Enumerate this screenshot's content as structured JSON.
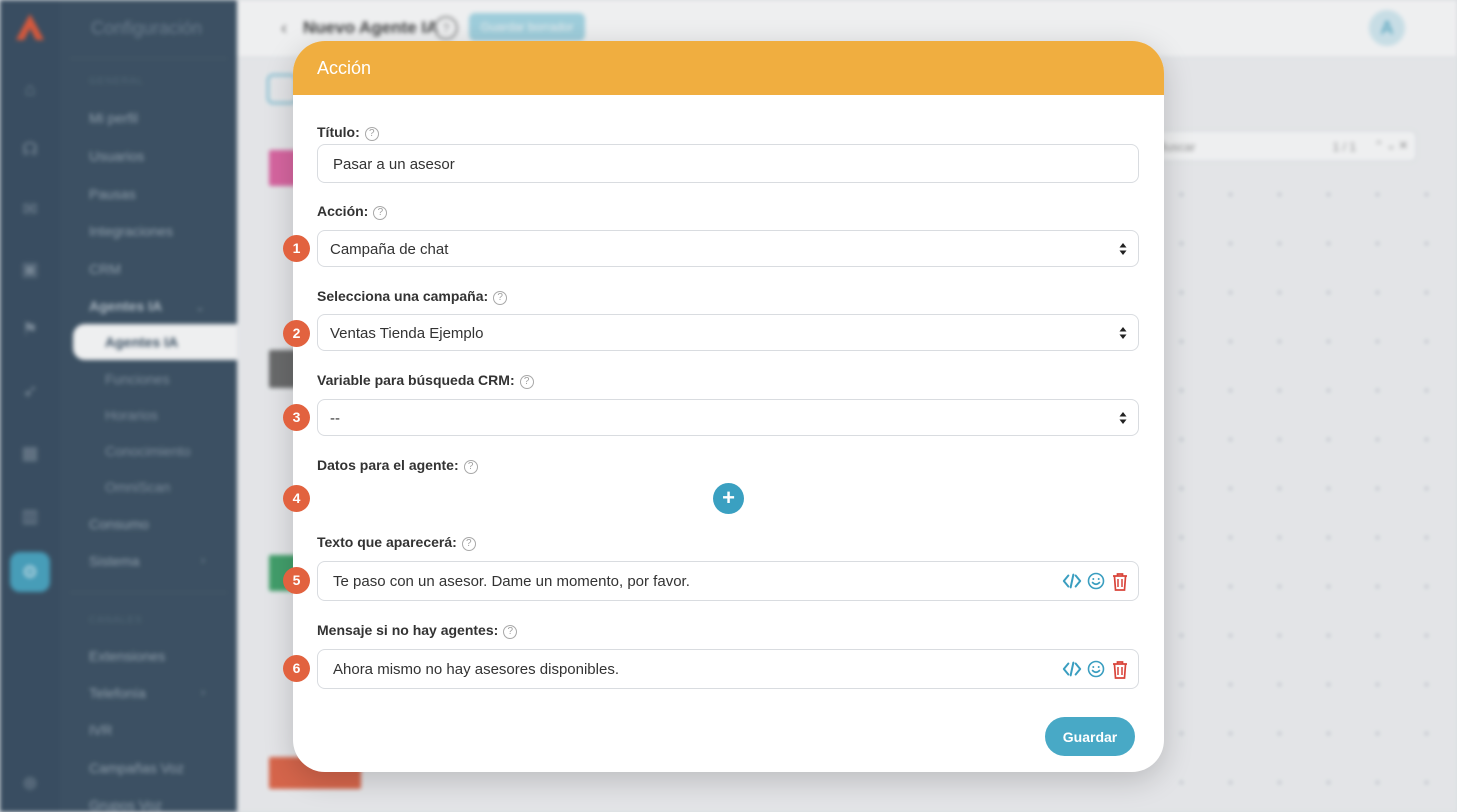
{
  "app": {
    "sidebar_title": "Configuración",
    "section_general": "GENERAL",
    "section_channels": "CANALES",
    "menu": {
      "mi_perfil": "Mi perfil",
      "usuarios": "Usuarios",
      "pausas": "Pausas",
      "integraciones": "Integraciones",
      "crm": "CRM",
      "agentes_ia": "Agentes IA",
      "sub_agentes_ia": "Agentes IA",
      "sub_funciones": "Funciones",
      "sub_horarios": "Horarios",
      "sub_conocimiento": "Conocimiento",
      "sub_omniscan": "OmniScan",
      "consumo": "Consumo",
      "sistema": "Sistema",
      "extensiones": "Extensiones",
      "telefonia": "Telefonía",
      "ivr": "IVR",
      "campanas_voz": "Campañas Voz",
      "grupos_voz": "Grupos Voz"
    },
    "page_title": "Nuevo Agente IA",
    "header_button": "Guardar borrador",
    "avatar_initial": "A",
    "search_placeholder": "Buscar",
    "search_count": "1 / 1"
  },
  "modal": {
    "title": "Acción",
    "fields": {
      "titulo_label": "Título:",
      "titulo_value": "Pasar a un asesor",
      "accion_label": "Acción:",
      "accion_value": "Campaña de chat",
      "campana_label": "Selecciona una campaña:",
      "campana_value": "Ventas Tienda Ejemplo",
      "variable_label": "Variable para búsqueda CRM:",
      "variable_value": "--",
      "datos_label": "Datos para el agente:",
      "texto_label": "Texto que aparecerá:",
      "texto_value": "Te paso con un asesor. Dame un momento, por favor.",
      "mensaje_label": "Mensaje si no hay agentes:",
      "mensaje_value": "Ahora mismo no hay asesores disponibles."
    },
    "badges": [
      "1",
      "2",
      "3",
      "4",
      "5",
      "6"
    ],
    "add_symbol": "+",
    "help_symbol": "?",
    "save_label": "Guardar"
  },
  "colors": {
    "header_orange": "#f0ae40",
    "badge_red": "#e2623f",
    "accent_blue": "#48a9c6",
    "delete_red": "#d9443a"
  },
  "icons": [
    "code-icon",
    "emoji-icon",
    "trash-icon",
    "plus-icon",
    "help-icon",
    "select-arrows-icon"
  ]
}
